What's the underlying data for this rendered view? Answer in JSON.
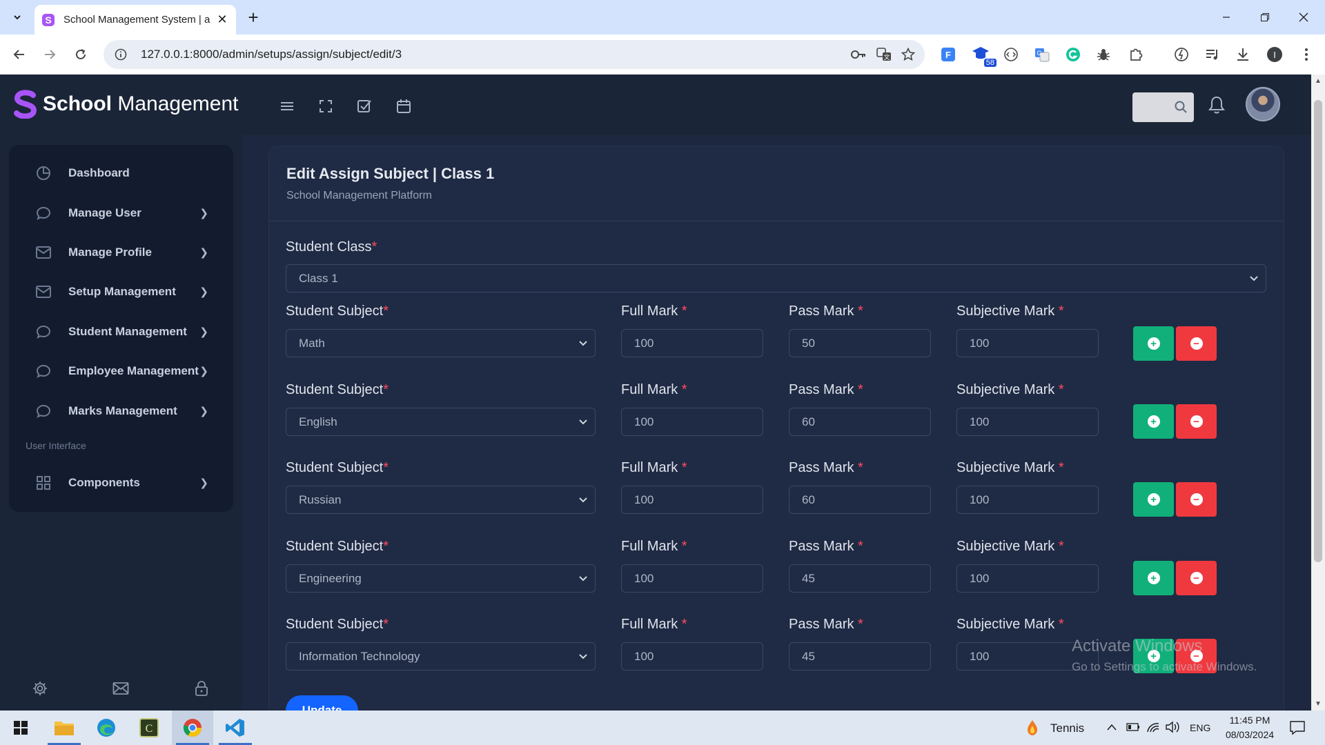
{
  "browser": {
    "tab_title": "School Management System | a",
    "url": "127.0.0.1:8000/admin/setups/assign/subject/edit/3",
    "extension_badge": "58"
  },
  "app": {
    "brand_bold": "School",
    "brand_rest": " Management",
    "sidebar": {
      "items": [
        {
          "label": "Dashboard",
          "icon": "pie-chart-icon",
          "has_chevron": false
        },
        {
          "label": "Manage User",
          "icon": "chat-bubble-icon",
          "has_chevron": true
        },
        {
          "label": "Manage Profile",
          "icon": "mail-icon",
          "has_chevron": true
        },
        {
          "label": "Setup Management",
          "icon": "mail-icon",
          "has_chevron": true
        },
        {
          "label": "Student Management",
          "icon": "chat-bubble-icon",
          "has_chevron": true
        },
        {
          "label": "Employee Management",
          "icon": "chat-bubble-icon",
          "has_chevron": true
        },
        {
          "label": "Marks Management",
          "icon": "chat-bubble-icon",
          "has_chevron": true
        }
      ],
      "section_label": "User Interface",
      "components_label": "Components"
    },
    "card": {
      "title": "Edit Assign Subject | Class 1",
      "subtitle": "School Management Platform"
    },
    "form": {
      "class_label": "Student Class",
      "class_value": "Class 1",
      "subject_label": "Student Subject",
      "full_mark_label": "Full Mark ",
      "pass_mark_label": "Pass Mark ",
      "subjective_mark_label": "Subjective Mark ",
      "required_mark": "*",
      "rows": [
        {
          "subject": "Math",
          "full_mark": "100",
          "pass_mark": "50",
          "subjective_mark": "100"
        },
        {
          "subject": "English",
          "full_mark": "100",
          "pass_mark": "60",
          "subjective_mark": "100"
        },
        {
          "subject": "Russian",
          "full_mark": "100",
          "pass_mark": "60",
          "subjective_mark": "100"
        },
        {
          "subject": "Engineering",
          "full_mark": "100",
          "pass_mark": "45",
          "subjective_mark": "100"
        },
        {
          "subject": "Information Technology",
          "full_mark": "100",
          "pass_mark": "45",
          "subjective_mark": "100"
        }
      ],
      "update_label": "Update"
    },
    "watermark": {
      "line1": "Activate Windows",
      "line2": "Go to Settings to activate Windows."
    }
  },
  "taskbar": {
    "weather": "Tennis",
    "language": "ENG",
    "time": "11:45 PM",
    "date": "08/03/2024"
  },
  "colors": {
    "page_bg": "#1b2538",
    "card_bg": "#1f2a44",
    "add_button": "#11b07a",
    "remove_button": "#f0393f",
    "update_button": "#1464ff",
    "brand_logo": "#a855f7"
  }
}
